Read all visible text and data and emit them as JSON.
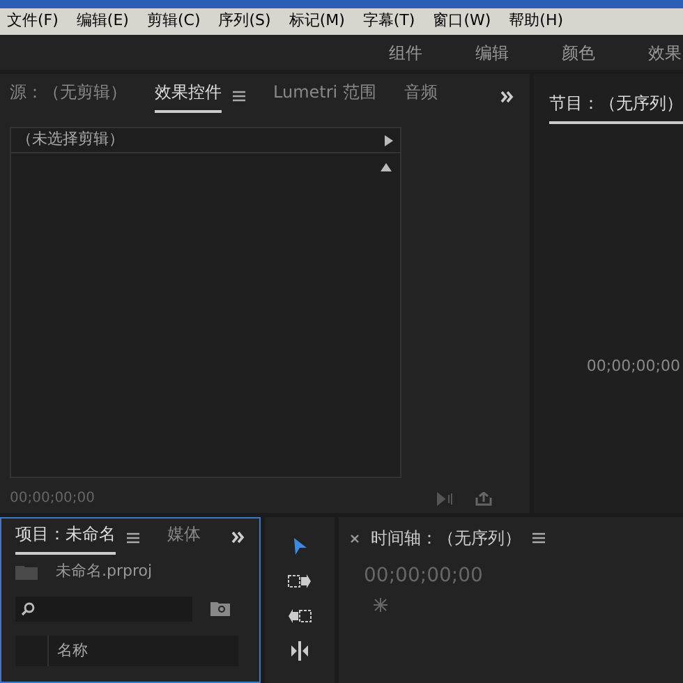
{
  "menu": [
    "文件(F)",
    "编辑(E)",
    "剪辑(C)",
    "序列(S)",
    "标记(M)",
    "字幕(T)",
    "窗口(W)",
    "帮助(H)"
  ],
  "workspaces": [
    "组件",
    "编辑",
    "颜色",
    "效果"
  ],
  "source_panel": {
    "tabs": [
      {
        "label": "源：（无剪辑）",
        "selected": false,
        "menu": false
      },
      {
        "label": "效果控件",
        "selected": true,
        "menu": true
      },
      {
        "label": "Lumetri 范围",
        "selected": false,
        "menu": false
      },
      {
        "label": "音频",
        "selected": false,
        "menu": false
      }
    ],
    "clip_header": "（未选择剪辑）",
    "timecode": "00;00;00;00"
  },
  "program_panel": {
    "tab": {
      "label": "节目：（无序列）",
      "selected": true
    },
    "timecode": "00;00;00;00"
  },
  "project_panel": {
    "tabs": [
      {
        "label": "项目：未命名",
        "selected": true,
        "menu": true
      },
      {
        "label": "媒体",
        "selected": false,
        "menu": false
      }
    ],
    "file": "未命名.prproj",
    "column": "名称"
  },
  "tools": [
    {
      "kind": "select",
      "selected": true
    },
    {
      "kind": "forward",
      "selected": false
    },
    {
      "kind": "backward",
      "selected": false
    },
    {
      "kind": "ripple",
      "selected": false
    }
  ],
  "timeline_panel": {
    "title": "时间轴：（无序列）",
    "timecode": "00;00;00;00"
  }
}
